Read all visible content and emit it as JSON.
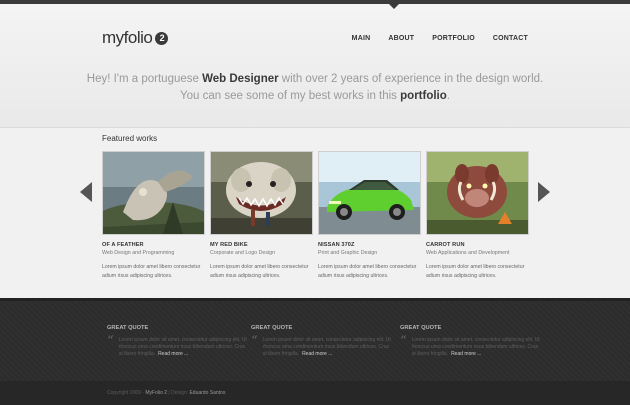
{
  "colors": {
    "background": "#eeeeee",
    "dark_footer": "#2e2e2e",
    "text_dark": "#333333",
    "text_light": "#9a9a9a"
  },
  "logo": {
    "text": "myfolio",
    "badge": "2"
  },
  "nav": {
    "items": [
      "MAIN",
      "ABOUT",
      "PORTFOLIO",
      "CONTACT"
    ]
  },
  "intro": {
    "part1": "Hey! I'm a portuguese ",
    "highlight1": "Web Designer",
    "part2": " with over 2 years of experience in the design world.",
    "part3": "You can see some of my best works in this ",
    "highlight2": "portfolio",
    "part4": "."
  },
  "featured": {
    "title": "Featured works",
    "items": [
      {
        "title": "OF A FEATHER",
        "category": "Web Design and Programming",
        "description": "Lorem ipsum dolor amet libero consectetur adium risus adipiscing ultrices.",
        "thumb_icon": "fantasy-creature-illustration"
      },
      {
        "title": "MY RED BIKE",
        "category": "Corporate and Logo Design",
        "description": "Lorem ipsum dolor amet libero consectetur adium risus adipiscing ultrices.",
        "thumb_icon": "monster-dog-illustration"
      },
      {
        "title": "NISSAN 370Z",
        "category": "Print and Graphic Design",
        "description": "Lorem ipsum dolor amet libero consectetur adium risus adipiscing ultrices.",
        "thumb_icon": "green-sports-car"
      },
      {
        "title": "CARROT RUN",
        "category": "Web Applications and Development",
        "description": "Lorem ipsum dolor amet libero consectetur adium risus adipiscing ultrices.",
        "thumb_icon": "boar-creature-illustration"
      }
    ]
  },
  "quotes": [
    {
      "title": "GREAT QUOTE",
      "text": "Lorem ipsum dolor sit amet, consectetur adipiscing elit. Ut rhoncus urna condimentum risus bibendum ultrices. Cras ut libero fringilla.",
      "link": "Read more ..."
    },
    {
      "title": "GREAT QUOTE",
      "text": "Lorem ipsum dolor sit amet, consectetur adipiscing elit. Ut rhoncus urna condimentum risus bibendum ultrices. Cras ut libero fringilla.",
      "link": "Read more ..."
    },
    {
      "title": "GREAT QUOTE",
      "text": "Lorem ipsum dolor sit amet, consectetur adipiscing elit. Ut rhoncus urna condimentum risus bibendum ultrices. Cras ut libero fringilla.",
      "link": "Read more ..."
    }
  ],
  "footer": {
    "copyright_prefix": "Copyright 2009 · ",
    "brand": "MyFolio 2",
    "separator": "  |  Design: ",
    "author": "Eduardo Santos"
  }
}
